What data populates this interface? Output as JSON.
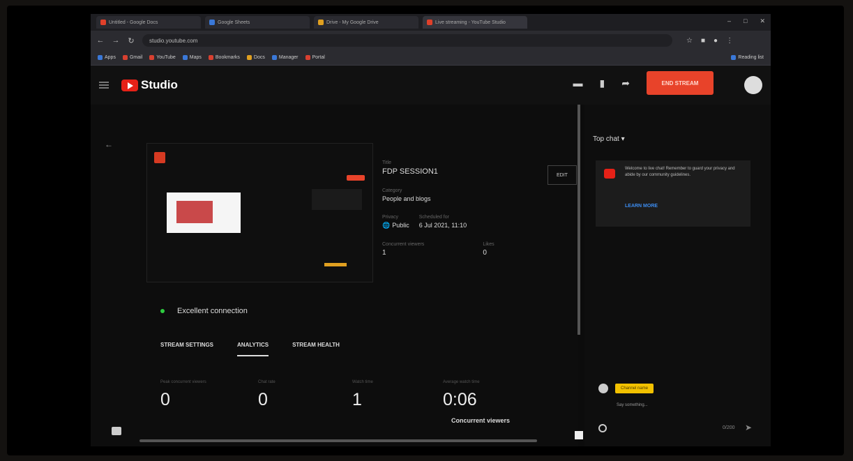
{
  "browser": {
    "tabs": [
      {
        "title": "Untitled - Google Docs"
      },
      {
        "title": "Google Sheets"
      },
      {
        "title": "Drive - My Google Drive"
      },
      {
        "title": "Live streaming - YouTube Studio"
      }
    ],
    "url": "studio.youtube.com",
    "bookmarks": [
      "Apps",
      "Gmail",
      "YouTube",
      "Maps",
      "Bookmarks",
      "Docs",
      "Manager",
      "Portal",
      "Reading list"
    ]
  },
  "header": {
    "logo_text": "Studio",
    "end_stream_label": "END STREAM"
  },
  "details": {
    "title_label": "Title",
    "title": "FDP SESSION1",
    "category_label": "Category",
    "category": "People and blogs",
    "privacy_label": "Privacy",
    "privacy": "Public",
    "scheduled_label": "Scheduled for",
    "scheduled": "6 Jul 2021, 11:10",
    "concurrent_label": "Concurrent viewers",
    "concurrent": "1",
    "likes_label": "Likes",
    "likes": "0",
    "edit_label": "EDIT"
  },
  "connection": {
    "status": "Excellent connection",
    "color": "#2ecc40"
  },
  "tabs": [
    "STREAM SETTINGS",
    "ANALYTICS",
    "STREAM HEALTH"
  ],
  "active_tab": "ANALYTICS",
  "metrics": [
    {
      "caption": "Peak concurrent viewers",
      "value": "0"
    },
    {
      "caption": "Chat rate",
      "value": "0"
    },
    {
      "caption": "Watch time",
      "value": "1"
    },
    {
      "caption": "Average watch time",
      "value": "0:06"
    }
  ],
  "concurrent_viewers_label": "Concurrent viewers",
  "chat": {
    "header": "Top chat",
    "welcome": "Welcome to live chat! Remember to guard your privacy and abide by our community guidelines.",
    "learn_more": "LEARN MORE",
    "username": "Channel name",
    "input_placeholder": "Say something...",
    "char_count": "0/200"
  },
  "colors": {
    "accent": "#e8432a",
    "yt_red": "#e62117",
    "link": "#3c8cf0",
    "chat_name": "#f2c100"
  }
}
